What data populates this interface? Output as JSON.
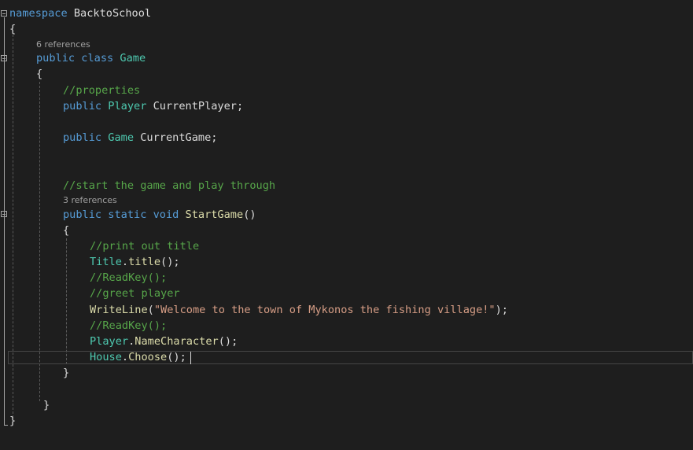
{
  "editor": {
    "namespace_kw": "namespace",
    "namespace_name": "BacktoSchool",
    "brace_open": "{",
    "brace_close": "}",
    "class_refs": "6 references",
    "class_kw": "public class",
    "class_name": "Game",
    "comment_properties": "//properties",
    "public_kw": "public",
    "player_type": "Player",
    "player_field": " CurrentPlayer;",
    "game_type": "Game",
    "game_field": " CurrentGame;",
    "comment_start": "//start the game and play through",
    "method_refs": "3 references",
    "method_kw": "public static void",
    "method_name": "StartGame",
    "method_parens": "()",
    "comment_print": "//print out title",
    "title_type": "Title",
    "title_call": "title",
    "call_end": "();",
    "comment_readkey": "//ReadKey();",
    "comment_greet": "//greet player",
    "writeline": "WriteLine",
    "paren_open": "(",
    "welcome_string": "\"Welcome to the town of Mykonos the fishing village!\"",
    "paren_close": ");",
    "player_class": "Player",
    "name_character": "NameCharacter",
    "house_class": "House",
    "choose": "Choose",
    "dot": "."
  },
  "colors": {
    "background": "#1e1e1e",
    "keyword": "#569cd6",
    "type": "#4ec9b0",
    "method": "#dcdcaa",
    "comment": "#57a64a",
    "string": "#d69d85",
    "text": "#dcdcdc"
  },
  "icons": [
    "collapse-icon"
  ]
}
